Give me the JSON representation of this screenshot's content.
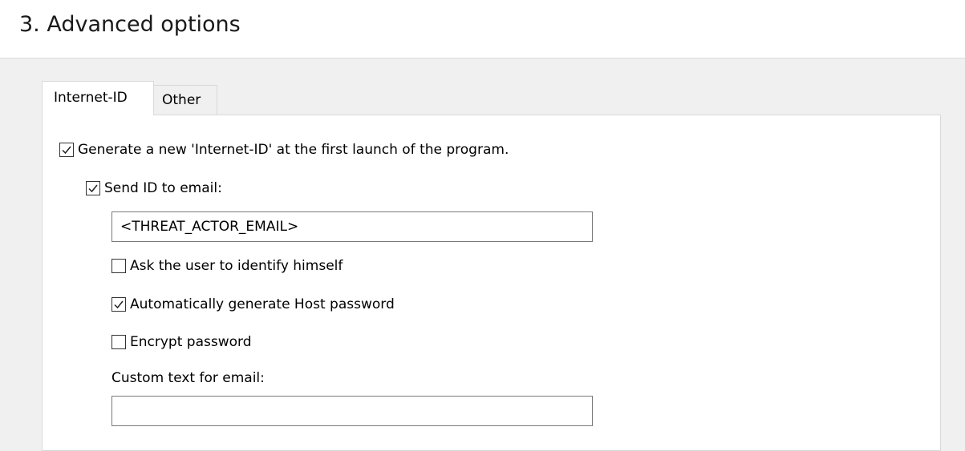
{
  "header": {
    "title": "3. Advanced options"
  },
  "tabs": [
    {
      "label": "Internet-ID",
      "active": true
    },
    {
      "label": "Other",
      "active": false
    }
  ],
  "options": {
    "generate_id": {
      "label": "Generate a new 'Internet-ID' at the first launch of the program.",
      "checked": true
    },
    "send_id": {
      "label": "Send ID to email:",
      "checked": true
    },
    "email_input": {
      "value": "<THREAT_ACTOR_EMAIL>"
    },
    "ask_identify": {
      "label": "Ask the user to identify himself",
      "checked": false
    },
    "auto_password": {
      "label": "Automatically generate Host password",
      "checked": true
    },
    "encrypt_password": {
      "label": "Encrypt password",
      "checked": false
    },
    "custom_text": {
      "label": "Custom text for email:",
      "value": ""
    }
  },
  "colors": {
    "background": "#f0f0f0",
    "panel": "#ffffff",
    "border": "#d9d9d9"
  }
}
